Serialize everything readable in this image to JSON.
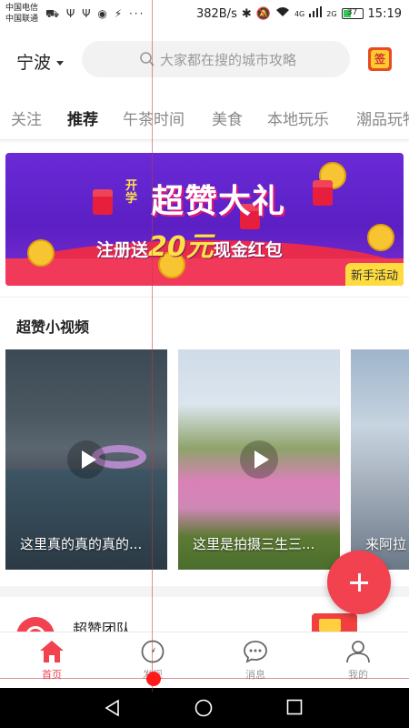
{
  "status_bar": {
    "carrier1": "中国电信",
    "carrier2": "中国联通",
    "left_icons": "⛟ Ψ Ψ ◉ ⚡ ···",
    "speed": "382B/s",
    "network_4g": "4G",
    "network_2g": "2G",
    "battery": "37",
    "time": "15:19"
  },
  "header": {
    "city": "宁波",
    "search_placeholder": "大家都在搜的城市攻略",
    "signin_icon_text": "签"
  },
  "tabs": [
    {
      "label": "关注",
      "active": false
    },
    {
      "label": "推荐",
      "active": true
    },
    {
      "label": "午茶时间",
      "active": false
    },
    {
      "label": "美食",
      "active": false
    },
    {
      "label": "本地玩乐",
      "active": false
    },
    {
      "label": "潮品玩物",
      "active": false
    }
  ],
  "banner": {
    "tag_top": "开学",
    "headline": "超赞大礼",
    "subtitle_prefix": "注册送",
    "amount": "20元",
    "subtitle_suffix": "现金红包",
    "badge": "新手活动"
  },
  "videos_section": {
    "title": "超赞小视频",
    "items": [
      {
        "caption": "这里真的真的真的..."
      },
      {
        "caption": "这里是拍摄三生三..."
      },
      {
        "caption": "来阿拉"
      }
    ]
  },
  "team": {
    "name": "超赞团队"
  },
  "bottom_nav": [
    {
      "label": "首页",
      "icon": "home-icon",
      "active": true
    },
    {
      "label": "发现",
      "icon": "compass-icon",
      "active": false
    },
    {
      "label": "消息",
      "icon": "message-icon",
      "active": false
    },
    {
      "label": "我的",
      "icon": "profile-icon",
      "active": false
    }
  ],
  "colors": {
    "accent": "#f2414f",
    "banner_purple": "#6a2ad6",
    "badge_yellow": "#ffdc3d"
  }
}
